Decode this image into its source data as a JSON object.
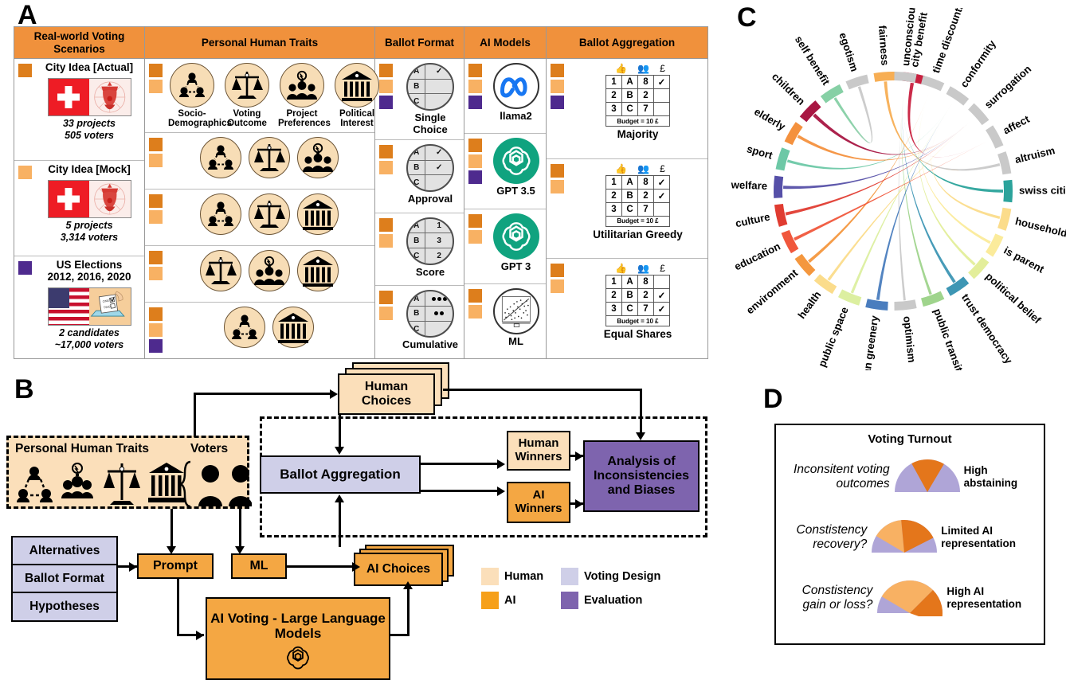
{
  "panels": {
    "a": "A",
    "b": "B",
    "c": "C",
    "d": "D"
  },
  "colors": {
    "header_orange": "#F0913C",
    "sw_dark": "#DD7E1C",
    "sw_light": "#F8B163",
    "sw_purple": "#4E2A8E",
    "human": "#FBDFBA",
    "ai": "#F4A743",
    "voting_design": "#CFCFE8",
    "evaluation": "#7E64AE"
  },
  "panelA": {
    "columns": [
      {
        "header": "Real-world Voting Scenarios"
      },
      {
        "header": "Personal Human Traits"
      },
      {
        "header": "Ballot Format"
      },
      {
        "header": "AI Models"
      },
      {
        "header": "Ballot Aggregation"
      }
    ],
    "scenarios": [
      {
        "title": "City Idea [Actual]",
        "swatches": [
          "dark"
        ],
        "projects": "33 projects",
        "voters": "505 voters",
        "image": "swiss-flag-city-idea"
      },
      {
        "title": "City Idea [Mock]",
        "swatches": [
          "light"
        ],
        "projects": "5 projects",
        "voters": "3,314 voters",
        "image": "swiss-flag-city-idea"
      },
      {
        "title": "US Elections",
        "subtitle": "2012, 2016, 2020",
        "swatches": [
          "purple"
        ],
        "projects": "2 candidates",
        "voters": "~17,000 voters",
        "image": "us-flag-ballot-box"
      }
    ],
    "trait_rows": [
      {
        "swatches": [
          "dark",
          "light"
        ],
        "traits": [
          {
            "icon": "socio-demographics-icon",
            "label": "Socio-Demographics"
          },
          {
            "icon": "voting-outcome-icon",
            "label": "Voting Outcome"
          },
          {
            "icon": "project-preferences-icon",
            "label": "Project Preferences"
          },
          {
            "icon": "political-interest-icon",
            "label": "Political Interest"
          }
        ]
      },
      {
        "swatches": [
          "dark",
          "light"
        ],
        "traits": [
          {
            "icon": "socio-demographics-icon",
            "label": ""
          },
          {
            "icon": "voting-outcome-icon",
            "label": ""
          },
          {
            "icon": "project-preferences-icon",
            "label": ""
          }
        ]
      },
      {
        "swatches": [
          "dark",
          "light"
        ],
        "traits": [
          {
            "icon": "socio-demographics-icon",
            "label": ""
          },
          {
            "icon": "voting-outcome-icon",
            "label": ""
          },
          {
            "icon": "political-interest-icon",
            "label": ""
          }
        ]
      },
      {
        "swatches": [
          "dark",
          "light"
        ],
        "traits": [
          {
            "icon": "voting-outcome-icon",
            "label": ""
          },
          {
            "icon": "project-preferences-icon",
            "label": ""
          },
          {
            "icon": "political-interest-icon",
            "label": ""
          }
        ]
      },
      {
        "swatches": [
          "dark",
          "light",
          "purple"
        ],
        "traits": [
          {
            "icon": "socio-demographics-icon",
            "label": ""
          },
          {
            "icon": "political-interest-icon",
            "label": ""
          }
        ]
      }
    ],
    "ballot_formats": [
      {
        "label": "Single Choice",
        "swatches": [
          "dark",
          "light",
          "purple"
        ],
        "rows": [
          [
            "A",
            "✓"
          ],
          [
            "B",
            ""
          ],
          [
            "C",
            ""
          ]
        ]
      },
      {
        "label": "Approval",
        "swatches": [
          "dark",
          "light"
        ],
        "rows": [
          [
            "A",
            "✓"
          ],
          [
            "B",
            "✓"
          ],
          [
            "C",
            ""
          ]
        ]
      },
      {
        "label": "Score",
        "swatches": [
          "dark",
          "light"
        ],
        "rows": [
          [
            "A",
            "1"
          ],
          [
            "B",
            "3"
          ],
          [
            "C",
            "2"
          ]
        ]
      },
      {
        "label": "Cumulative",
        "swatches": [
          "dark",
          "light"
        ],
        "rows": [
          [
            "A",
            "dots3"
          ],
          [
            "B",
            "dots2"
          ],
          [
            "C",
            ""
          ]
        ]
      }
    ],
    "ai_models": [
      {
        "label": "llama2",
        "icon": "meta-logo",
        "swatches": [
          "dark",
          "light",
          "purple"
        ]
      },
      {
        "label": "GPT 3.5",
        "icon": "openai-logo",
        "swatches": [
          "dark",
          "light",
          "purple"
        ]
      },
      {
        "label": "GPT 3",
        "icon": "openai-logo",
        "swatches": [
          "dark",
          "light"
        ]
      },
      {
        "label": "ML",
        "icon": "scatter-plot-icon",
        "swatches": [
          "dark",
          "light"
        ]
      }
    ],
    "aggregations": [
      {
        "label": "Majority",
        "swatches": [
          "dark",
          "light",
          "purple"
        ],
        "icons": [
          "thumbs-up-icon",
          "people-idea-icon",
          "pound-icon"
        ],
        "budget": "Budget = 10 £",
        "rows": [
          [
            "1",
            "A",
            "8",
            "✓"
          ],
          [
            "2",
            "B",
            "2",
            ""
          ],
          [
            "3",
            "C",
            "7",
            ""
          ]
        ]
      },
      {
        "label": "Utilitarian Greedy",
        "swatches": [
          "dark",
          "light"
        ],
        "icons": [
          "thumbs-up-icon",
          "people-idea-icon",
          "pound-icon"
        ],
        "budget": "Budget = 10 £",
        "rows": [
          [
            "1",
            "A",
            "8",
            "✓"
          ],
          [
            "2",
            "B",
            "2",
            "✓"
          ],
          [
            "3",
            "C",
            "7",
            ""
          ]
        ]
      },
      {
        "label": "Equal Shares",
        "swatches": [
          "dark",
          "light"
        ],
        "icons": [
          "thumbs-up-icon",
          "people-idea-icon",
          "pound-icon"
        ],
        "budget": "Budget = 10 £",
        "rows": [
          [
            "1",
            "A",
            "8",
            ""
          ],
          [
            "2",
            "B",
            "2",
            "✓"
          ],
          [
            "3",
            "C",
            "7",
            "✓"
          ]
        ]
      }
    ]
  },
  "panelB": {
    "nodes": {
      "human_traits": "Personal Human Traits",
      "voters": "Voters",
      "human_choices": "Human Choices",
      "ballot_aggregation": "Ballot Aggregation",
      "human_winners": "Human Winners",
      "ai_winners": "AI Winners",
      "analysis": "Analysis of Inconsistencies and Biases",
      "alternatives": "Alternatives",
      "ballot_format": "Ballot Format",
      "hypotheses": "Hypotheses",
      "prompt": "Prompt",
      "ml": "ML",
      "ai_choices": "AI Choices",
      "llm": "AI  Voting - Large Language Models"
    },
    "legend": [
      {
        "label": "Human",
        "color": "#FBDFBA"
      },
      {
        "label": "Voting Design",
        "color": "#CFCFE8"
      },
      {
        "label": "AI",
        "color": "#F4A743"
      },
      {
        "label": "Evaluation",
        "color": "#7E64AE"
      }
    ]
  },
  "chart_data": {
    "type": "chord",
    "title": "",
    "grid": false,
    "legend_position": "none",
    "groups": [
      {
        "label": "city benefit",
        "kind": "trait",
        "color": "#C8203F",
        "angle": -80
      },
      {
        "label": "fairness",
        "kind": "trait",
        "color": "#F7AE54",
        "angle": -94
      },
      {
        "label": "egotism",
        "kind": "trait",
        "color": "#C9C9C9",
        "angle": -108
      },
      {
        "label": "self benefit",
        "kind": "trait",
        "color": "#86D0A5",
        "angle": -122
      },
      {
        "label": "children",
        "kind": "trait",
        "color": "#A81642",
        "angle": -136
      },
      {
        "label": "elderly",
        "kind": "trait",
        "color": "#F4913E",
        "angle": -150
      },
      {
        "label": "sport",
        "kind": "trait",
        "color": "#6DC8A6",
        "angle": -164
      },
      {
        "label": "welfare",
        "kind": "trait",
        "color": "#5650A8",
        "angle": -178
      },
      {
        "label": "culture",
        "kind": "trait",
        "color": "#E03C31",
        "angle": -192
      },
      {
        "label": "education",
        "kind": "trait",
        "color": "#F0573C",
        "angle": -206
      },
      {
        "label": "environment",
        "kind": "trait",
        "color": "#F4973E",
        "angle": -220
      },
      {
        "label": "health",
        "kind": "trait",
        "color": "#FBDC8B",
        "angle": -234
      },
      {
        "label": "public space",
        "kind": "trait",
        "color": "#DCEFA0",
        "angle": -248
      },
      {
        "label": "urban greenery",
        "kind": "trait",
        "color": "#4A7DBE",
        "angle": -262
      },
      {
        "label": "optimism",
        "kind": "bias",
        "color": "#C9C9C9",
        "angle": -276
      },
      {
        "label": "public transit",
        "kind": "trait",
        "color": "#9FD48C",
        "angle": -290
      },
      {
        "label": "trust democracy",
        "kind": "trait",
        "color": "#3D96B4",
        "angle": -304
      },
      {
        "label": "political belief",
        "kind": "trait",
        "color": "#E3EE9A",
        "angle": -318
      },
      {
        "label": "is parent",
        "kind": "trait",
        "color": "#FBEB9B",
        "angle": -332
      },
      {
        "label": "household size",
        "kind": "trait",
        "color": "#FBDC8B",
        "angle": -346
      },
      {
        "label": "swiss citizenship",
        "kind": "trait",
        "color": "#2BA39B",
        "angle": -360
      },
      {
        "label": "altruism",
        "kind": "bias",
        "color": "#C9C9C9",
        "angle": -14
      },
      {
        "label": "affect",
        "kind": "bias",
        "color": "#C9C9C9",
        "angle": -28
      },
      {
        "label": "surrogation",
        "kind": "bias",
        "color": "#C9C9C9",
        "angle": -42
      },
      {
        "label": "conformity",
        "kind": "bias",
        "color": "#C9C9C9",
        "angle": -56
      },
      {
        "label": "time discounting",
        "kind": "bias",
        "color": "#C9C9C9",
        "angle": -70
      },
      {
        "label": "unconscious",
        "kind": "bias",
        "color": "#C9C9C9",
        "angle": -84
      }
    ],
    "links": [
      {
        "source": "city benefit",
        "target": "affect",
        "value": 9,
        "color": "#C8203F"
      },
      {
        "source": "fairness",
        "target": "altruism",
        "value": 8,
        "color": "#F7AE54"
      },
      {
        "source": "egotism",
        "target": "self benefit",
        "value": 7,
        "color": "#C9C9C9"
      },
      {
        "source": "self benefit",
        "target": "egotism",
        "value": 7,
        "color": "#86D0A5"
      },
      {
        "source": "children",
        "target": "surrogation",
        "value": 9,
        "color": "#A81642"
      },
      {
        "source": "elderly",
        "target": "surrogation",
        "value": 8,
        "color": "#F4913E"
      },
      {
        "source": "sport",
        "target": "conformity",
        "value": 7,
        "color": "#6DC8A6"
      },
      {
        "source": "welfare",
        "target": "surrogation",
        "value": 8,
        "color": "#5650A8"
      },
      {
        "source": "culture",
        "target": "surrogation",
        "value": 8,
        "color": "#E03C31"
      },
      {
        "source": "education",
        "target": "affect",
        "value": 8,
        "color": "#F0573C"
      },
      {
        "source": "environment",
        "target": "time discounting",
        "value": 8,
        "color": "#F4973E"
      },
      {
        "source": "health",
        "target": "surrogation",
        "value": 7,
        "color": "#FBDC8B"
      },
      {
        "source": "public space",
        "target": "conformity",
        "value": 7,
        "color": "#DCEFA0"
      },
      {
        "source": "urban greenery",
        "target": "conformity",
        "value": 8,
        "color": "#4A7DBE"
      },
      {
        "source": "optimism",
        "target": "unconscious",
        "value": 6,
        "color": "#C9C9C9"
      },
      {
        "source": "public transit",
        "target": "unconscious",
        "value": 7,
        "color": "#9FD48C"
      },
      {
        "source": "trust democracy",
        "target": "unconscious",
        "value": 8,
        "color": "#3D96B4"
      },
      {
        "source": "political belief",
        "target": "time discounting",
        "value": 7,
        "color": "#E3EE9A"
      },
      {
        "source": "is parent",
        "target": "time discounting",
        "value": 7,
        "color": "#FBEB9B"
      },
      {
        "source": "household size",
        "target": "conformity",
        "value": 7,
        "color": "#FBDC8B"
      },
      {
        "source": "swiss citizenship",
        "target": "unconscious",
        "value": 8,
        "color": "#2BA39B"
      },
      {
        "source": "altruism",
        "target": "fairness",
        "value": 7,
        "color": "#C9C9C9"
      }
    ]
  },
  "panelD": {
    "title": "Voting Turnout",
    "rows": [
      {
        "left": "Inconsitent voting outcomes",
        "right": "High abstaining",
        "dark_fraction": 0.33,
        "light_fraction": 0.0
      },
      {
        "left": "Constistency recovery?",
        "right": "Limited AI representation",
        "dark_fraction": 0.38,
        "light_fraction": 0.3
      },
      {
        "left": "Constistency gain or loss?",
        "right": "High AI representation",
        "dark_fraction": 0.36,
        "light_fraction": 0.58
      }
    ]
  }
}
